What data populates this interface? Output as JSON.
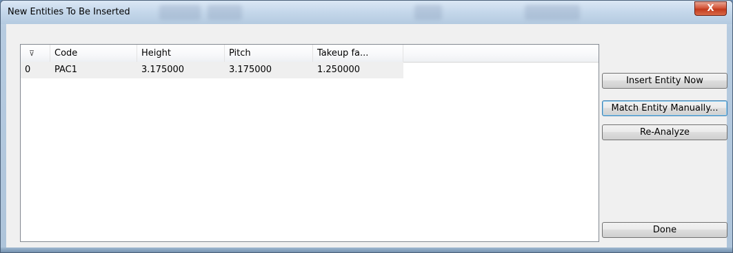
{
  "window": {
    "title": "New Entities To Be Inserted",
    "close_glyph": "X"
  },
  "list": {
    "columns": [
      "",
      "Code",
      "Height",
      "Pitch",
      "Takeup fa..."
    ],
    "sort_indicator": "⊽",
    "rows": [
      {
        "index": "0",
        "code": "PAC1",
        "height": "3.175000",
        "pitch": "3.175000",
        "takeup": "1.250000"
      }
    ]
  },
  "buttons": {
    "insert": "Insert Entity Now",
    "match": "Match Entity Manually...",
    "reanalyze": "Re-Analyze",
    "done": "Done"
  }
}
